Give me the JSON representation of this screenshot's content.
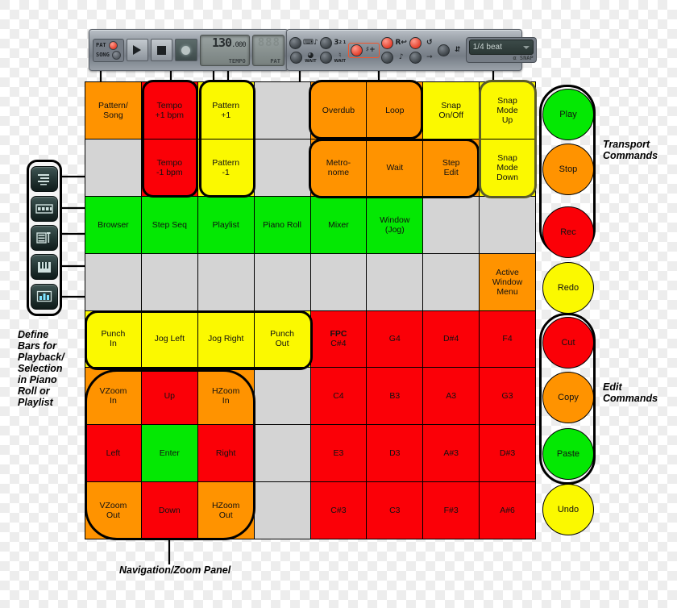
{
  "toolbars": {
    "transport": {
      "pat_label": "PAT",
      "song_label": "SONG",
      "play_icon": "play-icon",
      "stop_icon": "stop-icon",
      "record_icon": "record-icon",
      "tempo": {
        "value": "130",
        "decimals": ".000",
        "caption": "TEMPO"
      },
      "pattern": {
        "value": "888",
        "caption": "PAT"
      }
    },
    "options": {
      "controls": [
        {
          "name": "typing-keyboard-to-piano",
          "glyph": "⌨"
        },
        {
          "name": "multilink-channels",
          "glyph": "3",
          "sub": "2 1"
        },
        {
          "name": "overdub-blend-notes",
          "glyph": "♫+",
          "highlight": true
        },
        {
          "name": "step-edit-record",
          "glyph": "R",
          "highlight": true
        },
        {
          "name": "loop-record",
          "glyph": "↺"
        },
        {
          "name": "wait-for-input",
          "glyph": "⌕",
          "sub": "WAIT"
        },
        {
          "name": "metronome",
          "glyph": "♪"
        },
        {
          "name": "countdown-before-recording",
          "glyph": "→"
        },
        {
          "name": "snap-magnet",
          "glyph": "⚓"
        }
      ],
      "snap": {
        "value": "1/4 beat",
        "caption": "SNAP"
      }
    }
  },
  "window_icons": [
    {
      "name": "browser-icon"
    },
    {
      "name": "step-sequencer-icon"
    },
    {
      "name": "playlist-icon"
    },
    {
      "name": "piano-roll-icon"
    },
    {
      "name": "mixer-icon"
    }
  ],
  "grid": {
    "rows": [
      [
        {
          "label": "Pattern/\nSong",
          "color": "orange"
        },
        {
          "label": "Tempo\n+1 bpm",
          "color": "red"
        },
        {
          "label": "Pattern\n+1",
          "color": "yellow"
        },
        {
          "label": "",
          "color": "gray"
        },
        {
          "label": "Overdub",
          "color": "orange"
        },
        {
          "label": "Loop",
          "color": "orange"
        },
        {
          "label": "Snap\nOn/Off",
          "color": "yellow"
        },
        {
          "label": "Snap\nMode\nUp",
          "color": "yellow"
        }
      ],
      [
        {
          "label": "",
          "color": "gray"
        },
        {
          "label": "Tempo\n-1 bpm",
          "color": "red"
        },
        {
          "label": "Pattern\n-1",
          "color": "yellow"
        },
        {
          "label": "",
          "color": "gray"
        },
        {
          "label": "Metro-\nnome",
          "color": "orange"
        },
        {
          "label": "Wait",
          "color": "orange"
        },
        {
          "label": "Step\nEdit",
          "color": "orange"
        },
        {
          "label": "Snap\nMode\nDown",
          "color": "yellow"
        }
      ],
      [
        {
          "label": "Browser",
          "color": "green"
        },
        {
          "label": "Step Seq",
          "color": "green"
        },
        {
          "label": "Playlist",
          "color": "green"
        },
        {
          "label": "Piano Roll",
          "color": "green"
        },
        {
          "label": "Mixer",
          "color": "green"
        },
        {
          "label": "Window\n(Jog)",
          "color": "green"
        },
        {
          "label": "",
          "color": "gray"
        },
        {
          "label": "",
          "color": "gray"
        }
      ],
      [
        {
          "label": "",
          "color": "gray"
        },
        {
          "label": "",
          "color": "gray"
        },
        {
          "label": "",
          "color": "gray"
        },
        {
          "label": "",
          "color": "gray"
        },
        {
          "label": "",
          "color": "gray"
        },
        {
          "label": "",
          "color": "gray"
        },
        {
          "label": "",
          "color": "gray"
        },
        {
          "label": "Active\nWindow\nMenu",
          "color": "orange"
        }
      ],
      [
        {
          "label": "Punch\nIn",
          "color": "yellow"
        },
        {
          "label": "Jog Left",
          "color": "yellow"
        },
        {
          "label": "Jog Right",
          "color": "yellow"
        },
        {
          "label": "Punch\nOut",
          "color": "yellow"
        },
        {
          "label": "FPC\nC#4",
          "color": "red",
          "bold_first": true
        },
        {
          "label": "G4",
          "color": "red"
        },
        {
          "label": "D#4",
          "color": "red"
        },
        {
          "label": "F4",
          "color": "red"
        }
      ],
      [
        {
          "label": "VZoom\nIn",
          "color": "orange"
        },
        {
          "label": "Up",
          "color": "red"
        },
        {
          "label": "HZoom\nIn",
          "color": "orange"
        },
        {
          "label": "",
          "color": "gray"
        },
        {
          "label": "C4",
          "color": "red"
        },
        {
          "label": "B3",
          "color": "red"
        },
        {
          "label": "A3",
          "color": "red"
        },
        {
          "label": "G3",
          "color": "red"
        }
      ],
      [
        {
          "label": "Left",
          "color": "red"
        },
        {
          "label": "Enter",
          "color": "green"
        },
        {
          "label": "Right",
          "color": "red"
        },
        {
          "label": "",
          "color": "gray"
        },
        {
          "label": "E3",
          "color": "red"
        },
        {
          "label": "D3",
          "color": "red"
        },
        {
          "label": "A#3",
          "color": "red"
        },
        {
          "label": "D#3",
          "color": "red"
        }
      ],
      [
        {
          "label": "VZoom\nOut",
          "color": "orange"
        },
        {
          "label": "Down",
          "color": "red"
        },
        {
          "label": "HZoom\nOut",
          "color": "orange"
        },
        {
          "label": "",
          "color": "gray"
        },
        {
          "label": "C#3",
          "color": "red"
        },
        {
          "label": "C3",
          "color": "red"
        },
        {
          "label": "F#3",
          "color": "red"
        },
        {
          "label": "A#6",
          "color": "red"
        }
      ]
    ]
  },
  "side_buttons": {
    "transport": [
      {
        "label": "Play",
        "color": "green"
      },
      {
        "label": "Stop",
        "color": "orange"
      },
      {
        "label": "Rec",
        "color": "red"
      }
    ],
    "redo": {
      "label": "Redo",
      "color": "yellow"
    },
    "edit": [
      {
        "label": "Cut",
        "color": "red"
      },
      {
        "label": "Copy",
        "color": "orange"
      },
      {
        "label": "Paste",
        "color": "green"
      }
    ],
    "undo": {
      "label": "Undo",
      "color": "yellow"
    }
  },
  "annotations": {
    "transport_commands": "Transport\nCommands",
    "edit_commands": "Edit\nCommands",
    "define_bars": "Define\nBars for\nPlayback/\nSelection\nin Piano\nRoll or\nPlaylist",
    "nav_zoom_panel": "Navigation/Zoom Panel"
  },
  "colors": {
    "orange": "#ff9300",
    "red": "#fb0007",
    "yellow": "#fbf900",
    "green": "#04e803",
    "gray": "#d4d4d4",
    "outline": "#000000",
    "outline_olive": "#5a5b2a"
  }
}
